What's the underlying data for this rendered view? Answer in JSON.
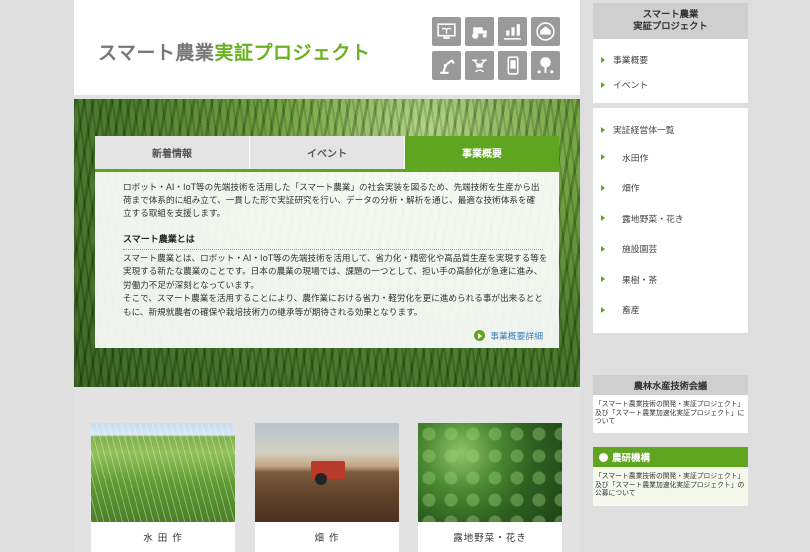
{
  "header": {
    "logo_part1": "スマート農業",
    "logo_part2": "実証プロジェクト",
    "icons": [
      "computer-sprout-icon",
      "tractor-icon",
      "field-graph-icon",
      "greenhouse-icon",
      "robot-arm-icon",
      "drone-icon",
      "smartphone-icon",
      "tree-network-icon"
    ]
  },
  "panel": {
    "tabs": [
      "新着情報",
      "イベント",
      "事業概要"
    ],
    "active_tab": 2,
    "intro": "ロボット・AI・IoT等の先端技術を活用した「スマート農業」の社会実装を図るため、先端技術を生産から出荷まで体系的に組み立て、一貫した形で実証研究を行い、データの分析・解析を通じ、最適な技術体系を確立する取組を支援します。",
    "subheading": "スマート農業とは",
    "body1": "スマート農業とは、ロボット・AI・IoT等の先端技術を活用して、省力化・精密化や高品質生産を実現する等を実現する新たな農業のことです。日本の農業の現場では、課題の一つとして、担い手の高齢化が急速に進み、労働力不足が深刻となっています。",
    "body2": "そこで、スマート農業を活用することにより、農作業における省力・軽労化を更に進められる事が出来るとともに、新規就農者の確保や栽培技術力の継承等が期待される効果となります。",
    "more_link": "事業概要詳細"
  },
  "cards": [
    "水 田 作",
    "畑 作",
    "露地野菜・花き"
  ],
  "sidebar": {
    "title_line1": "スマート農業",
    "title_line2": "実証プロジェクト",
    "group1": [
      "事業概要",
      "イベント"
    ],
    "group2_title": "実証経営体一覧",
    "group2": [
      "水田作",
      "畑作",
      "露地野菜・花き",
      "施設園芸",
      "果樹・茶",
      "畜産"
    ]
  },
  "banner1": {
    "title": "農林水産技術会議",
    "text": "「スマート農業技術の開発・実証プロジェクト」及び「スマート農業加速化実証プロジェクト」について"
  },
  "banner2": {
    "title": "農研機構",
    "text": "「スマート農業技術の開発・実証プロジェクト」及び「スマート農業加速化実証プロジェクト」の公募について"
  },
  "colors": {
    "accent": "#5fa51f",
    "link": "#3a7fc1",
    "tile": "#9a9a9a"
  }
}
